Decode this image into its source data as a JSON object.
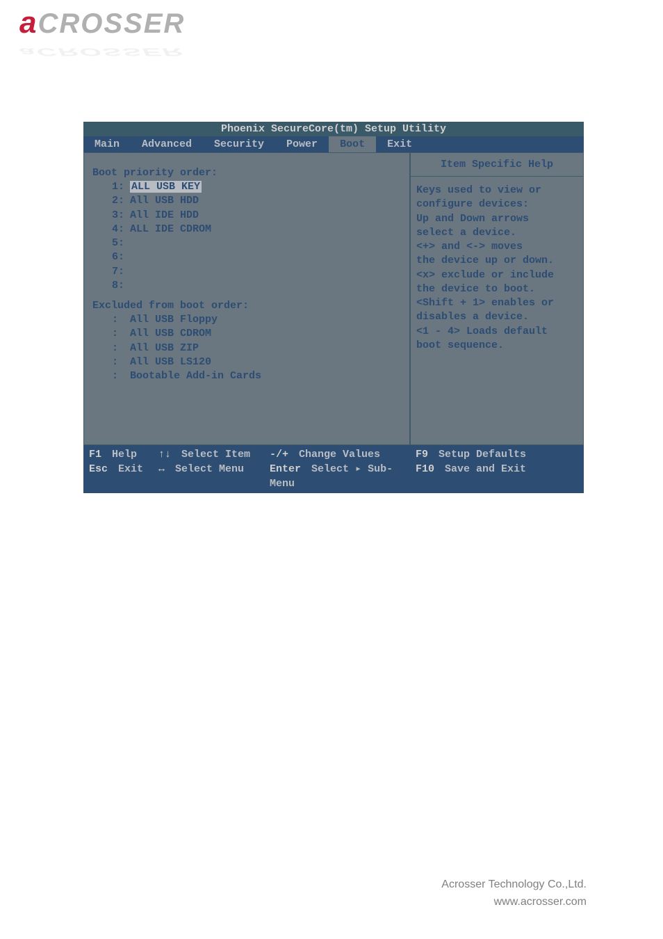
{
  "logo": {
    "first": "a",
    "rest": "CROSSER"
  },
  "bios": {
    "title": "Phoenix SecureCore(tm) Setup Utility",
    "tabs": [
      "Main",
      "Advanced",
      "Security",
      "Power",
      "Boot",
      "Exit"
    ],
    "active_tab": "Boot",
    "boot_priority_label": "Boot priority order:",
    "boot_items": [
      {
        "idx": "1:",
        "val": "ALL USB KEY",
        "selected": true
      },
      {
        "idx": "2:",
        "val": "All USB HDD",
        "selected": false
      },
      {
        "idx": "3:",
        "val": "All IDE HDD",
        "selected": false
      },
      {
        "idx": "4:",
        "val": "ALL IDE CDROM",
        "selected": false
      },
      {
        "idx": "5:",
        "val": "",
        "selected": false
      },
      {
        "idx": "6:",
        "val": "",
        "selected": false
      },
      {
        "idx": "7:",
        "val": "",
        "selected": false
      },
      {
        "idx": "8:",
        "val": "",
        "selected": false
      }
    ],
    "excluded_label": "Excluded from boot order:",
    "excluded_items": [
      {
        "idx": ":",
        "val": "All USB Floppy"
      },
      {
        "idx": ":",
        "val": "All USB CDROM"
      },
      {
        "idx": ":",
        "val": "All USB ZIP"
      },
      {
        "idx": ":",
        "val": "All USB LS120"
      },
      {
        "idx": ":",
        "val": "Bootable Add-in Cards"
      }
    ],
    "help": {
      "title": "Item Specific Help",
      "lines": [
        "Keys used to view or",
        "configure devices:",
        "Up and Down arrows",
        "select a device.",
        "<+> and <-> moves",
        "the device up or down.",
        "<x> exclude or include",
        "the device to boot.",
        "<Shift + 1> enables or",
        "disables a device.",
        "<1 - 4> Loads default",
        "boot sequence."
      ]
    },
    "footer": {
      "row1": [
        {
          "key": "F1",
          "label": "Help"
        },
        {
          "key": "↑↓",
          "label": "Select Item"
        },
        {
          "key": "-/+",
          "label": "Change Values"
        },
        {
          "key": "F9",
          "label": "Setup Defaults"
        }
      ],
      "row2": [
        {
          "key": "Esc",
          "label": "Exit"
        },
        {
          "key": "↔",
          "label": "Select Menu"
        },
        {
          "key": "Enter",
          "label": "Select ▸ Sub-Menu"
        },
        {
          "key": "F10",
          "label": "Save and Exit"
        }
      ]
    }
  },
  "company": {
    "name": "Acrosser Technology Co.,Ltd.",
    "url": "www.acrosser.com"
  }
}
